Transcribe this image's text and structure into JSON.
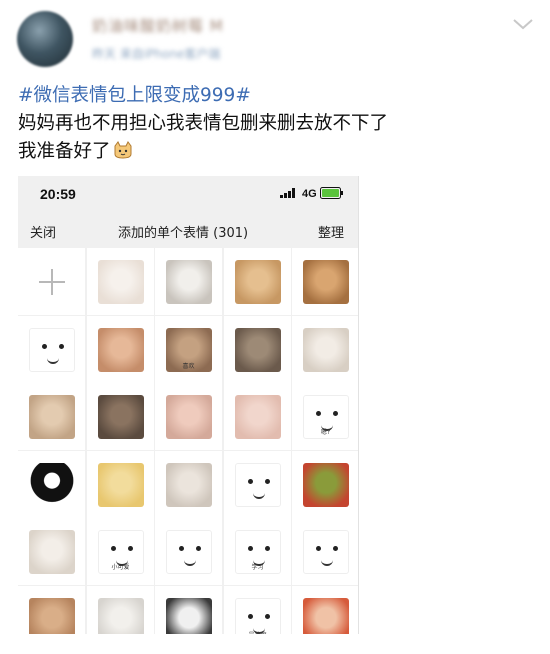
{
  "post": {
    "username": "奶油味酸奶树莓 M",
    "meta": "昨天 来自iPhone客户端",
    "hashtag": "#微信表情包上限变成999#",
    "line1": "妈妈再也不用担心我表情包删来删去放不下了",
    "line2": "我准备好了"
  },
  "phone": {
    "status": {
      "time": "20:59",
      "network": "4G"
    },
    "nav": {
      "close": "关闭",
      "title": "添加的单个表情 (301)",
      "organize": "整理"
    }
  },
  "colors": {
    "hashtag": "#3d6cb3",
    "grid_bg": "#f0f0f0",
    "cell_bg": "#ffffff"
  },
  "stickers": [
    {
      "name": "add-sticker",
      "kind": "plus"
    },
    {
      "name": "white-puppy",
      "kind": "photo",
      "bg": "#e9dfd6",
      "fg": "#f6f1ec"
    },
    {
      "name": "polar-bear",
      "kind": "photo",
      "bg": "#c9c4bd",
      "fg": "#f1efeb"
    },
    {
      "name": "shiba-inu",
      "kind": "photo",
      "bg": "#c79863",
      "fg": "#e5bf8f"
    },
    {
      "name": "orange-cat",
      "kind": "photo",
      "bg": "#a57040",
      "fg": "#d9a570"
    },
    {
      "name": "cartoon-scream",
      "kind": "draw",
      "bg": "#ffffff",
      "fg": "#ffffff"
    },
    {
      "name": "chubby-cat",
      "kind": "photo",
      "bg": "#c58d6a",
      "fg": "#e6b898"
    },
    {
      "name": "tabby-cat",
      "kind": "photo",
      "bg": "#8d6b52",
      "fg": "#c4a181",
      "caption": "喜欢"
    },
    {
      "name": "kids-photo",
      "kind": "photo",
      "bg": "#6b5a4c",
      "fg": "#9d8a76"
    },
    {
      "name": "white-cat",
      "kind": "photo",
      "bg": "#d8cfc4",
      "fg": "#f2ece5"
    },
    {
      "name": "kitten",
      "kind": "photo",
      "bg": "#c2a486",
      "fg": "#e3cbb0"
    },
    {
      "name": "man-photo",
      "kind": "photo",
      "bg": "#5b4b3f",
      "fg": "#8a7360"
    },
    {
      "name": "baby-face",
      "kind": "photo",
      "bg": "#d4a99a",
      "fg": "#efcbbd"
    },
    {
      "name": "baby-closeup",
      "kind": "photo",
      "bg": "#e2bcaf",
      "fg": "#f1d6cc"
    },
    {
      "name": "meme-face-question",
      "kind": "draw",
      "bg": "#ffffff",
      "fg": "#ffffff",
      "caption": "嗯?"
    },
    {
      "name": "panda-silhouette",
      "kind": "draw",
      "bg": "#ffffff",
      "fg": "#111111"
    },
    {
      "name": "doge-sketch",
      "kind": "photo",
      "bg": "#e8c76f",
      "fg": "#f2dc9c"
    },
    {
      "name": "cat-closeup",
      "kind": "photo",
      "bg": "#cfc6bc",
      "fg": "#ebe4dc"
    },
    {
      "name": "doodle-face",
      "kind": "draw",
      "bg": "#ffffff",
      "fg": "#ffffff"
    },
    {
      "name": "pepe-frog",
      "kind": "photo",
      "bg": "#c4452f",
      "fg": "#8a9b3a"
    },
    {
      "name": "fluffy-dog",
      "kind": "photo",
      "bg": "#dcd4ca",
      "fg": "#f3eee8"
    },
    {
      "name": "bunny-doodle",
      "kind": "draw",
      "bg": "#ffffff",
      "fg": "#ffffff",
      "caption": "小可爱"
    },
    {
      "name": "meme-man-cup",
      "kind": "draw",
      "bg": "#ffffff",
      "fg": "#ffffff"
    },
    {
      "name": "panda-meme",
      "kind": "draw",
      "bg": "#ffffff",
      "fg": "#ffffff",
      "caption": "学习"
    },
    {
      "name": "meme-face-small",
      "kind": "draw",
      "bg": "#ffffff",
      "fg": "#ffffff"
    },
    {
      "name": "cat-bottom-1",
      "kind": "photo",
      "bg": "#b6845e",
      "fg": "#d9ae88"
    },
    {
      "name": "white-dog-bottom",
      "kind": "photo",
      "bg": "#d7d4cf",
      "fg": "#f2f0ec"
    },
    {
      "name": "panda-photo",
      "kind": "photo",
      "bg": "#3a3a3a",
      "fg": "#f0f0f0"
    },
    {
      "name": "meme-bottom",
      "kind": "draw",
      "bg": "#ffffff",
      "fg": "#ffffff",
      "caption": "最美嘛"
    },
    {
      "name": "red-meme-bottom",
      "kind": "photo",
      "bg": "#d65b3b",
      "fg": "#f0c2a6"
    }
  ]
}
